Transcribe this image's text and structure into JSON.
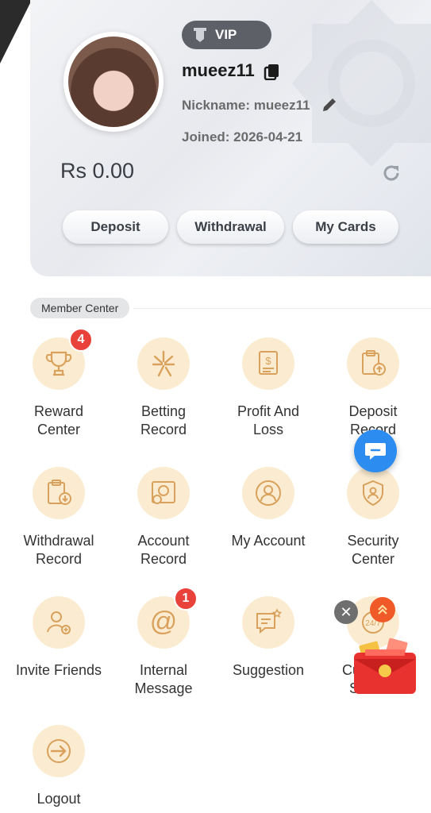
{
  "profile": {
    "vip_label": "VIP",
    "username": "mueez11",
    "nickname": "Nickname: mueez11",
    "joined": "Joined:  2026-04-21",
    "balance": "Rs 0.00"
  },
  "actions": {
    "deposit": "Deposit",
    "withdrawal": "Withdrawal",
    "cards": "My Cards"
  },
  "section": {
    "title": "Member Center"
  },
  "menu": [
    {
      "label": "Reward Center",
      "icon": "trophy-icon",
      "badge": "4"
    },
    {
      "label": "Betting Record",
      "icon": "betting-record-icon"
    },
    {
      "label": "Profit And Loss",
      "icon": "profit-loss-icon"
    },
    {
      "label": "Deposit Record",
      "icon": "deposit-record-icon"
    },
    {
      "label": "Withdrawal Record",
      "icon": "withdrawal-record-icon"
    },
    {
      "label": "Account Record",
      "icon": "account-record-icon"
    },
    {
      "label": "My Account",
      "icon": "user-icon"
    },
    {
      "label": "Security Center",
      "icon": "security-shield-icon"
    },
    {
      "label": "Invite Friends",
      "icon": "invite-friends-icon"
    },
    {
      "label": "Internal Message",
      "icon": "at-sign-icon",
      "badge": "1"
    },
    {
      "label": "Suggestion",
      "icon": "suggestion-icon"
    },
    {
      "label": "Customer Service",
      "icon": "customer-service-icon"
    },
    {
      "label": "Logout",
      "icon": "logout-icon"
    }
  ],
  "colors": {
    "accent": "#fbecd1",
    "icon_stroke": "#d9a15c",
    "badge": "#e8423b",
    "chat": "#2d8cf0"
  }
}
